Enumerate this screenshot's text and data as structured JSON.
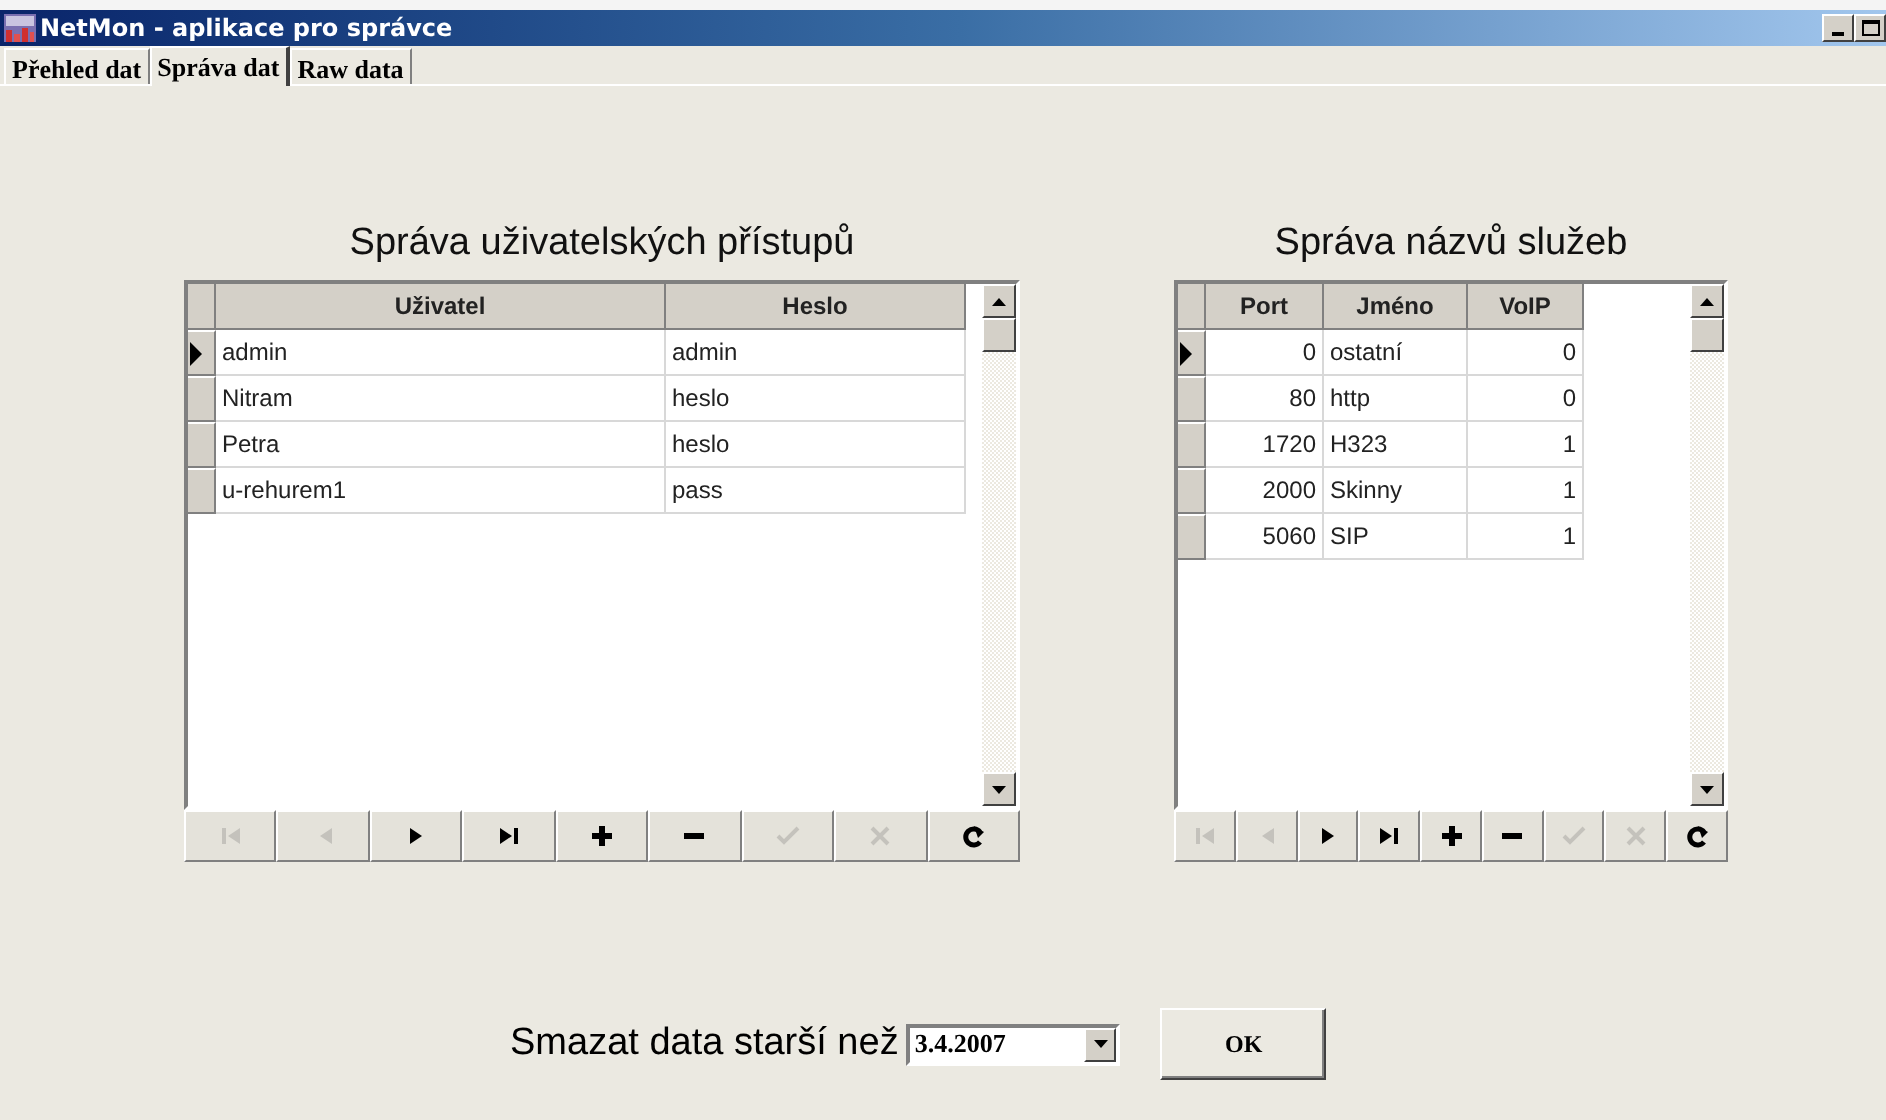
{
  "window": {
    "title": "NetMon - aplikace pro správce"
  },
  "tabs": [
    {
      "label": "Přehled dat",
      "selected": false
    },
    {
      "label": "Správa dat",
      "selected": true
    },
    {
      "label": "Raw data",
      "selected": false
    }
  ],
  "users": {
    "title": "Správa uživatelských přístupů",
    "columns": [
      {
        "label": "Uživatel",
        "kind": "text"
      },
      {
        "label": "Heslo",
        "kind": "text"
      }
    ],
    "rows": [
      {
        "cells": [
          "admin",
          "admin"
        ],
        "current": true
      },
      {
        "cells": [
          "Nitram",
          "heslo"
        ],
        "current": false
      },
      {
        "cells": [
          "Petra",
          "heslo"
        ],
        "current": false
      },
      {
        "cells": [
          "u-rehurem1",
          "pass"
        ],
        "current": false
      }
    ],
    "navigator": [
      {
        "kind": "first",
        "disabled": true
      },
      {
        "kind": "prior",
        "disabled": true
      },
      {
        "kind": "next",
        "disabled": false
      },
      {
        "kind": "last",
        "disabled": false
      },
      {
        "kind": "insert",
        "disabled": false
      },
      {
        "kind": "delete",
        "disabled": false
      },
      {
        "kind": "post",
        "disabled": true
      },
      {
        "kind": "cancel",
        "disabled": true
      },
      {
        "kind": "refresh",
        "disabled": false
      }
    ]
  },
  "services": {
    "title": "Správa názvů služeb",
    "columns": [
      {
        "label": "Port",
        "kind": "number"
      },
      {
        "label": "Jméno",
        "kind": "text"
      },
      {
        "label": "VoIP",
        "kind": "number"
      }
    ],
    "rows": [
      {
        "cells": [
          "0",
          "ostatní",
          "0"
        ],
        "current": true
      },
      {
        "cells": [
          "80",
          "http",
          "0"
        ],
        "current": false
      },
      {
        "cells": [
          "1720",
          "H323",
          "1"
        ],
        "current": false
      },
      {
        "cells": [
          "2000",
          "Skinny",
          "1"
        ],
        "current": false
      },
      {
        "cells": [
          "5060",
          "SIP",
          "1"
        ],
        "current": false
      }
    ],
    "navigator": [
      {
        "kind": "first",
        "disabled": true
      },
      {
        "kind": "prior",
        "disabled": true
      },
      {
        "kind": "next",
        "disabled": false
      },
      {
        "kind": "last",
        "disabled": false
      },
      {
        "kind": "insert",
        "disabled": false
      },
      {
        "kind": "delete",
        "disabled": false
      },
      {
        "kind": "post",
        "disabled": true
      },
      {
        "kind": "cancel",
        "disabled": true
      },
      {
        "kind": "refresh",
        "disabled": false
      }
    ]
  },
  "purge": {
    "label": "Smazat data starší než",
    "date": "3.4.2007",
    "ok": "OK"
  }
}
